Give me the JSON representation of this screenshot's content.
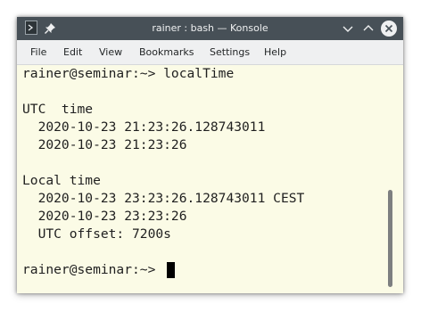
{
  "window": {
    "title": "rainer : bash — Konsole"
  },
  "titlebar_icons": {
    "app": "terminal-icon",
    "pin": "pin-icon",
    "minimize": "chevron-down-icon",
    "maximize": "chevron-up-icon",
    "close": "close-icon"
  },
  "menu": {
    "file": "File",
    "edit": "Edit",
    "view": "View",
    "bookmarks": "Bookmarks",
    "settings": "Settings",
    "help": "Help"
  },
  "terminal": {
    "lines": [
      "rainer@seminar:~> localTime",
      "",
      "UTC  time",
      "  2020-10-23 21:23:26.128743011",
      "  2020-10-23 21:23:26",
      "",
      "Local time",
      "  2020-10-23 23:23:26.128743011 CEST",
      "  2020-10-23 23:23:26",
      "  UTC offset: 7200s",
      "",
      "rainer@seminar:~> "
    ]
  },
  "colors": {
    "titlebar": "#475057",
    "menubar": "#eff0f1",
    "terminal_background": "#fbfbe6",
    "terminal_text": "#1f1f1f"
  }
}
